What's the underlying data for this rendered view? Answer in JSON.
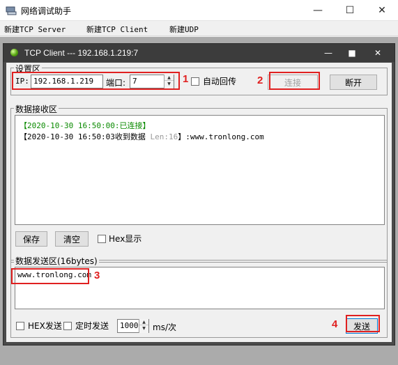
{
  "window": {
    "title": "网络调试助手",
    "icon": "app-icon",
    "buttons": {
      "minimize": "—",
      "maximize": "☐",
      "close": "✕"
    }
  },
  "menu": {
    "items": [
      "新建TCP Server",
      "新建TCP Client",
      "新建UDP"
    ]
  },
  "child": {
    "title": "TCP Client --- 192.168.1.219:7",
    "buttons": {
      "minimize": "—",
      "maximize": "■",
      "close": "✕"
    },
    "status_color": "#58a512"
  },
  "settings": {
    "legend": "设置区",
    "ip_label": "IP:",
    "ip_value": "192.168.1.219",
    "port_label": "端口:",
    "port_value": "7",
    "auto_reply_label": "自动回传",
    "auto_reply_checked": false,
    "connect_label": "连接",
    "disconnect_label": "断开"
  },
  "receive": {
    "legend": "数据接收区",
    "lines": [
      {
        "bracket_open": "【",
        "time": "2020-10-30 16:50:00:",
        "status": "已连接",
        "bracket_close": "】"
      },
      {
        "prefix": "【2020-10-30 16:50:03收到数据 ",
        "len": "Len:16",
        "suffix": "】:www.tronlong.com"
      }
    ],
    "save_label": "保存",
    "clear_label": "清空",
    "hex_display_label": "Hex显示",
    "hex_display_checked": false
  },
  "send": {
    "legend": "数据发送区(16bytes)",
    "text": "www.tronlong.com",
    "hex_send_label": "HEX发送",
    "hex_send_checked": false,
    "timed_send_label": "定时发送",
    "timed_send_checked": false,
    "interval_value": "1000",
    "interval_unit": "ms/次",
    "send_label": "发送"
  },
  "annotations": {
    "marks": [
      "1",
      "2",
      "3",
      "4"
    ],
    "color": "#e02020"
  }
}
